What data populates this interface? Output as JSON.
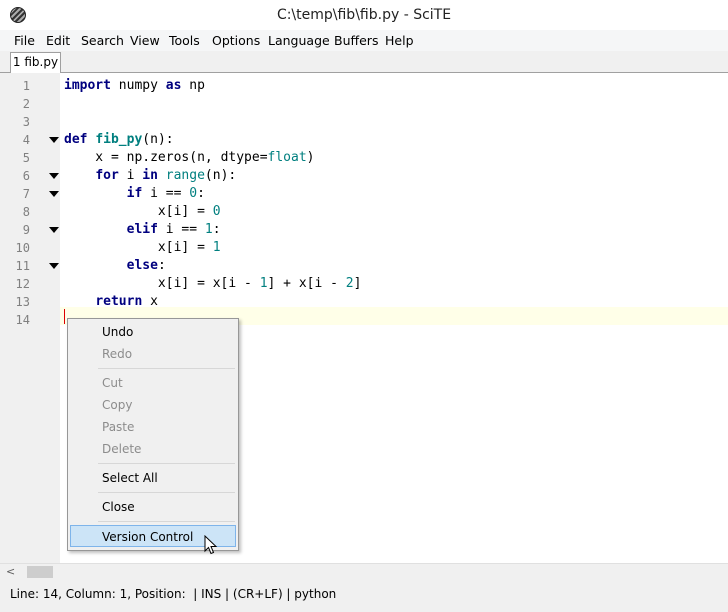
{
  "window": {
    "title": "C:\\temp\\fib\\fib.py - SciTE"
  },
  "menu": [
    "File",
    "Edit",
    "Search",
    "View",
    "Tools",
    "Options",
    "Language",
    "Buffers",
    "Help"
  ],
  "tab": {
    "label": "1 fib.py"
  },
  "editor": {
    "line_numbers": [
      "1",
      "2",
      "3",
      "4",
      "5",
      "6",
      "7",
      "8",
      "9",
      "10",
      "11",
      "12",
      "13",
      "14"
    ],
    "lines": [
      [
        [
          "kw",
          "import"
        ],
        [
          "id",
          " numpy "
        ],
        [
          "kw",
          "as"
        ],
        [
          "id",
          " np"
        ]
      ],
      [],
      [],
      [
        [
          "kw",
          "def"
        ],
        [
          "id",
          " "
        ],
        [
          "fn",
          "fib_py"
        ],
        [
          "op",
          "("
        ],
        [
          "id",
          "n"
        ],
        [
          "op",
          "):"
        ]
      ],
      [
        [
          "id",
          "    x "
        ],
        [
          "op",
          "="
        ],
        [
          "id",
          " np"
        ],
        [
          "op",
          "."
        ],
        [
          "id",
          "zeros"
        ],
        [
          "op",
          "("
        ],
        [
          "id",
          "n"
        ],
        [
          "op",
          ", "
        ],
        [
          "id",
          "dtype"
        ],
        [
          "op",
          "="
        ],
        [
          "bi",
          "float"
        ],
        [
          "op",
          ")"
        ]
      ],
      [
        [
          "id",
          "    "
        ],
        [
          "kw",
          "for"
        ],
        [
          "id",
          " i "
        ],
        [
          "kw",
          "in"
        ],
        [
          "id",
          " "
        ],
        [
          "bi",
          "range"
        ],
        [
          "op",
          "("
        ],
        [
          "id",
          "n"
        ],
        [
          "op",
          "):"
        ]
      ],
      [
        [
          "id",
          "        "
        ],
        [
          "kw",
          "if"
        ],
        [
          "id",
          " i "
        ],
        [
          "op",
          "=="
        ],
        [
          "id",
          " "
        ],
        [
          "num",
          "0"
        ],
        [
          "op",
          ":"
        ]
      ],
      [
        [
          "id",
          "            x"
        ],
        [
          "op",
          "["
        ],
        [
          "id",
          "i"
        ],
        [
          "op",
          "]"
        ],
        [
          "id",
          " "
        ],
        [
          "op",
          "="
        ],
        [
          "id",
          " "
        ],
        [
          "num",
          "0"
        ]
      ],
      [
        [
          "id",
          "        "
        ],
        [
          "kw",
          "elif"
        ],
        [
          "id",
          " i "
        ],
        [
          "op",
          "=="
        ],
        [
          "id",
          " "
        ],
        [
          "num",
          "1"
        ],
        [
          "op",
          ":"
        ]
      ],
      [
        [
          "id",
          "            x"
        ],
        [
          "op",
          "["
        ],
        [
          "id",
          "i"
        ],
        [
          "op",
          "]"
        ],
        [
          "id",
          " "
        ],
        [
          "op",
          "="
        ],
        [
          "id",
          " "
        ],
        [
          "num",
          "1"
        ]
      ],
      [
        [
          "id",
          "        "
        ],
        [
          "kw",
          "else"
        ],
        [
          "op",
          ":"
        ]
      ],
      [
        [
          "id",
          "            x"
        ],
        [
          "op",
          "["
        ],
        [
          "id",
          "i"
        ],
        [
          "op",
          "]"
        ],
        [
          "id",
          " "
        ],
        [
          "op",
          "="
        ],
        [
          "id",
          " x"
        ],
        [
          "op",
          "["
        ],
        [
          "id",
          "i "
        ],
        [
          "op",
          "-"
        ],
        [
          "id",
          " "
        ],
        [
          "num",
          "1"
        ],
        [
          "op",
          "]"
        ],
        [
          "id",
          " "
        ],
        [
          "op",
          "+"
        ],
        [
          "id",
          " x"
        ],
        [
          "op",
          "["
        ],
        [
          "id",
          "i "
        ],
        [
          "op",
          "-"
        ],
        [
          "id",
          " "
        ],
        [
          "num",
          "2"
        ],
        [
          "op",
          "]"
        ]
      ],
      [
        [
          "id",
          "    "
        ],
        [
          "kw",
          "return"
        ],
        [
          "id",
          " x"
        ]
      ],
      []
    ],
    "fold_markers": [
      "4",
      "6",
      "7",
      "9",
      "11"
    ]
  },
  "context_menu": {
    "items": [
      {
        "label": "Undo",
        "enabled": true
      },
      {
        "label": "Redo",
        "enabled": false
      },
      {
        "label": "Cut",
        "enabled": false
      },
      {
        "label": "Copy",
        "enabled": false
      },
      {
        "label": "Paste",
        "enabled": false
      },
      {
        "label": "Delete",
        "enabled": false
      },
      {
        "label": "Select All",
        "enabled": true
      },
      {
        "label": "Close",
        "enabled": true
      },
      {
        "label": "Version Control",
        "enabled": true,
        "highlighted": true
      }
    ]
  },
  "status": {
    "text": "Line: 14, Column: 1, Position:  | INS | (CR+LF) | python"
  },
  "scrollbar": {
    "left_arrow": "<"
  },
  "colors": {
    "keyword": "#00007f",
    "number": "#007f7f",
    "caret_line": "#ffffe8",
    "menu_highlight": "#cce4f7"
  }
}
